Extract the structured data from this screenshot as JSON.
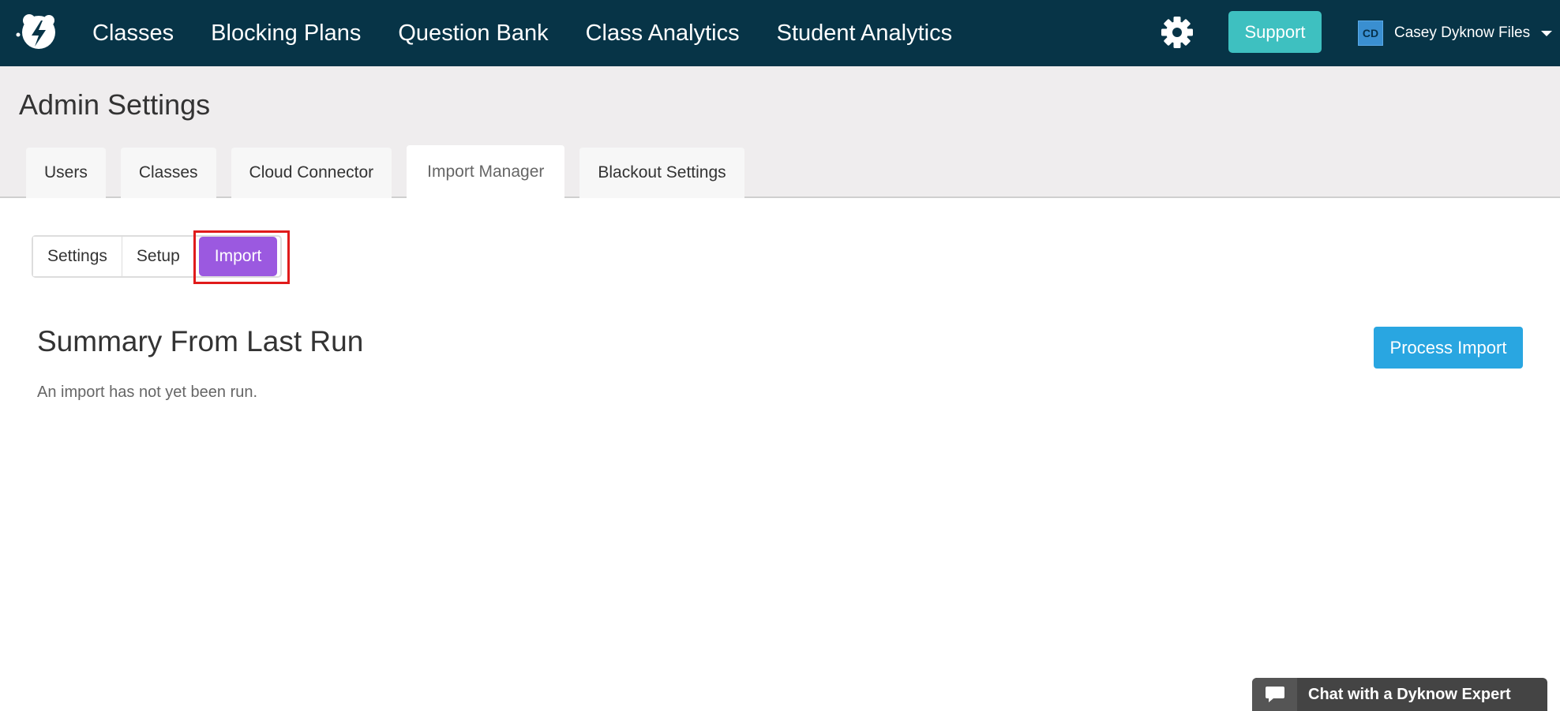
{
  "nav": {
    "links": [
      "Classes",
      "Blocking Plans",
      "Question Bank",
      "Class Analytics",
      "Student Analytics"
    ],
    "support_label": "Support",
    "user": {
      "initials": "CD",
      "name": "Casey Dyknow Files"
    },
    "icons": {
      "logo": "dyknow-logo-icon",
      "settings": "gear-icon",
      "caret": "chevron-down-icon"
    }
  },
  "page": {
    "title": "Admin Settings",
    "tabs": [
      "Users",
      "Classes",
      "Cloud Connector",
      "Import Manager",
      "Blackout Settings"
    ],
    "active_tab": "Import Manager"
  },
  "subtabs": {
    "items": [
      "Settings",
      "Setup",
      "Import"
    ],
    "active": "Import"
  },
  "summary": {
    "title": "Summary From Last Run",
    "text": "An import has not yet been run.",
    "process_label": "Process Import"
  },
  "chat": {
    "label": "Chat with a Dyknow Expert",
    "icon": "chat-bubble-icon"
  },
  "colors": {
    "nav_bg": "#073447",
    "support": "#3ec0c0",
    "active_subtab": "#9b59e0",
    "primary_button": "#29a6e1",
    "highlight": "#e01b1b"
  }
}
